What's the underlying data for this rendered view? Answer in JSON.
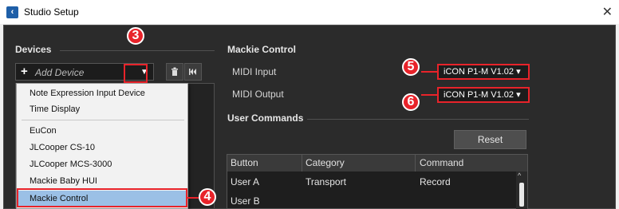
{
  "window": {
    "title": "Studio Setup",
    "close_symbol": "✕"
  },
  "devices": {
    "heading": "Devices",
    "add_device_label": "Add Device",
    "delete_icon": "trash-icon",
    "reset_icon": "skip-back-icon"
  },
  "menu": {
    "items": [
      "Note Expression Input Device",
      "Time Display",
      "EuCon",
      "JLCooper CS-10",
      "JLCooper MCS-3000",
      "Mackie Baby HUI",
      "Mackie Control"
    ],
    "selected": "Mackie Control"
  },
  "mackie": {
    "heading": "Mackie Control",
    "midi_input_label": "MIDI Input",
    "midi_input_value": "iCON P1-M V1.02 ▾",
    "midi_output_label": "MIDI Output",
    "midi_output_value": "iCON P1-M V1.02 ▾",
    "user_commands_heading": "User Commands",
    "reset_label": "Reset"
  },
  "table": {
    "headers": [
      "Button",
      "Category",
      "Command"
    ],
    "rows": [
      [
        "User A",
        "Transport",
        "Record"
      ],
      [
        "User B",
        "",
        ""
      ]
    ]
  },
  "callouts": {
    "c3": "3",
    "c4": "4",
    "c5": "5",
    "c6": "6"
  },
  "colors": {
    "accent_red": "#e8232a",
    "panel_bg": "#2b2b2b",
    "menu_selected": "#9bc0e6"
  }
}
